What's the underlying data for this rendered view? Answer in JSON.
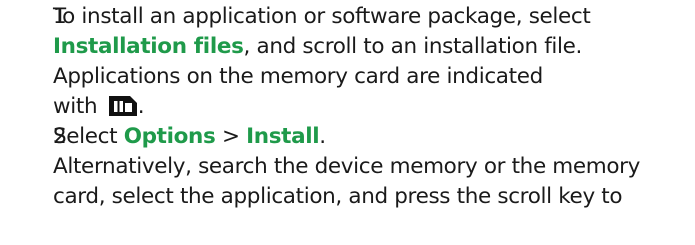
{
  "steps": [
    {
      "number": "1",
      "line1_pre": "To install an application or software package, select",
      "line2_keyword": "Installation files",
      "line2_post": ", and scroll to an installation file.",
      "line3": "Applications on the memory card are indicated",
      "line4_pre": "with",
      "line4_icon": "memory-card-icon",
      "line4_post": "."
    },
    {
      "number": "2",
      "line1_pre": "Select ",
      "keyword1": "Options",
      "separator": " > ",
      "keyword2": "Install",
      "line1_post": ".",
      "line2": "Alternatively, search the device memory or the memory",
      "line3": "card, select the application, and press the scroll key to"
    }
  ],
  "colors": {
    "keyword": "#1f9a4a",
    "text": "#1a1a1a"
  }
}
